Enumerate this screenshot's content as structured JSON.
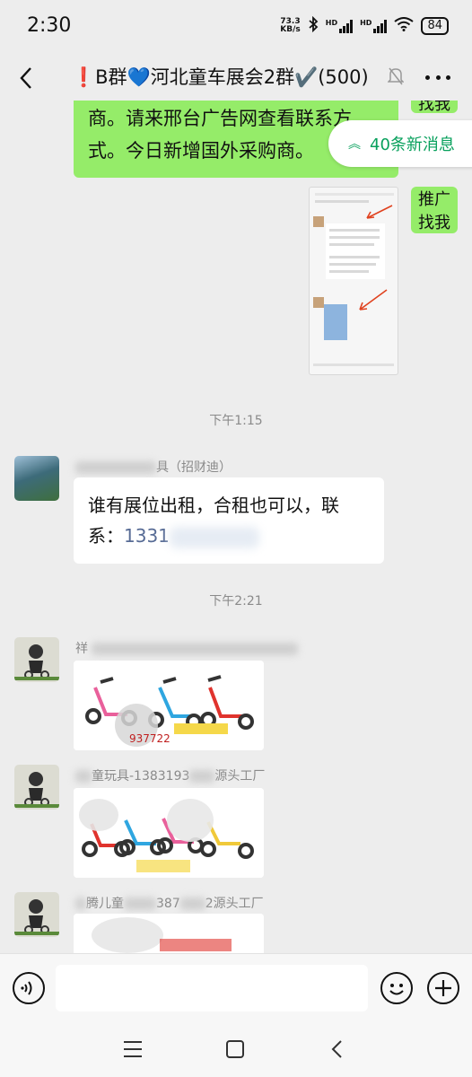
{
  "status_bar": {
    "time": "2:30",
    "speed_value": "73.3",
    "speed_unit": "KB/s",
    "hd_label": "HD",
    "battery": "84"
  },
  "header": {
    "title_prefix": "❗",
    "title_a": "B群",
    "title_heart": "💙",
    "title_b": "河北童车展会2群✔️(500)"
  },
  "messages": {
    "msg1_text": "商。请来邢台广告网查看联系方式。今日新增国外采购商。",
    "side_tag_top": "找我",
    "side_tag_promo": "推广找我",
    "new_messages_label": "40条新消息",
    "time_1": "下午1:15",
    "sender_2": "具（招财迪）",
    "msg2_text": "谁有展位出租，合租也可以，联系：",
    "msg2_phone": "1331",
    "time_2": "下午2:21",
    "sender_3": "祥",
    "img3_caption": "937722",
    "sender_4": "童玩具-1383193",
    "sender_4_suffix": "源头工厂",
    "sender_5": "腾儿童",
    "sender_5_mid": "387",
    "sender_5_suffix": "2源头工厂"
  },
  "colors": {
    "accent_green": "#07a05c",
    "bubble_green": "#95ec69",
    "link_blue": "#576b95"
  }
}
